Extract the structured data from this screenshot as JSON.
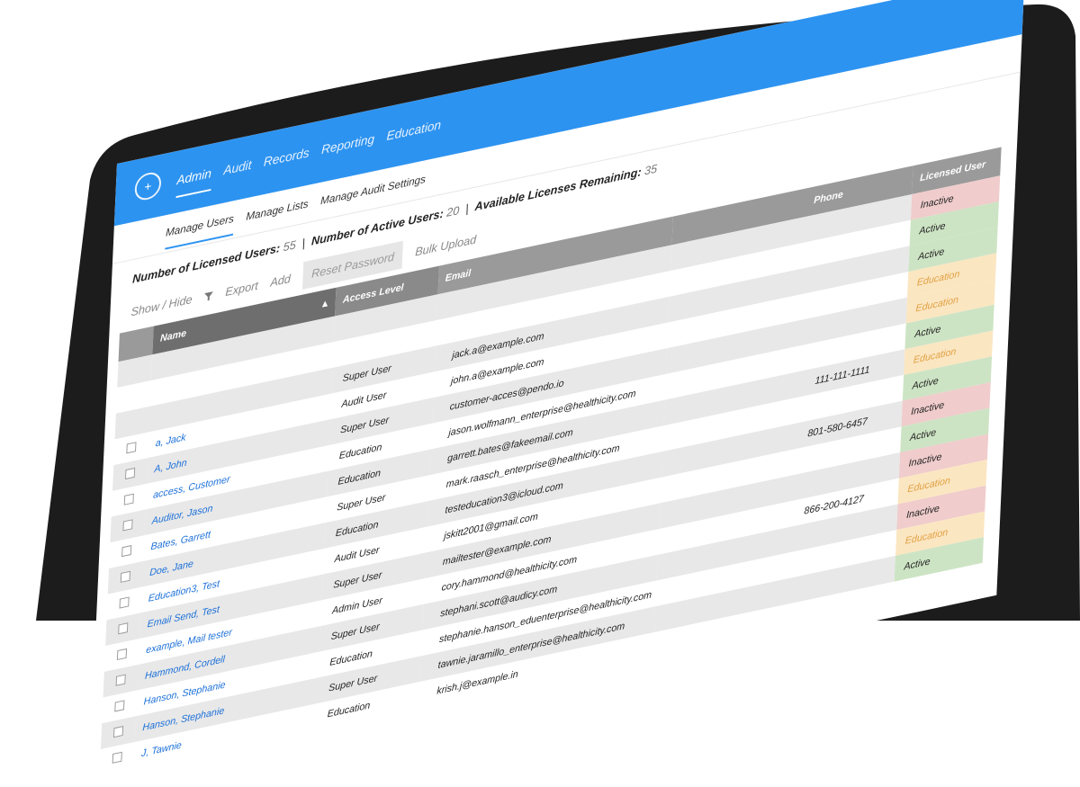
{
  "nav": {
    "items": [
      "Admin",
      "Audit",
      "Records",
      "Reporting",
      "Education"
    ],
    "active": "Admin"
  },
  "subnav": {
    "items": [
      "Manage Users",
      "Manage Lists",
      "Manage Audit Settings"
    ],
    "active": "Manage Users"
  },
  "counts": {
    "licensed_label": "Number of Licensed Users:",
    "licensed_value": "55",
    "active_label": "Number of Active Users:",
    "active_value": "20",
    "available_label": "Available Licenses Remaining:",
    "available_value": "35"
  },
  "toolbar": {
    "show_hide": "Show / Hide",
    "export": "Export",
    "add": "Add",
    "reset_password": "Reset Password",
    "bulk_upload": "Bulk Upload"
  },
  "table": {
    "headers": {
      "name": "Name",
      "access": "Access Level",
      "email": "Email",
      "phone": "Phone",
      "licensed": "Licensed User"
    },
    "rows": [
      {
        "name": "",
        "access": "",
        "email": "",
        "phone": "",
        "licensed": "Inactive"
      },
      {
        "name": "",
        "access": "",
        "email": "",
        "phone": "",
        "licensed": "Active"
      },
      {
        "name": "",
        "access": "Super User",
        "email": "jack.a@example.com",
        "phone": "",
        "licensed": "Active"
      },
      {
        "name": "a, Jack",
        "access": "Audit User",
        "email": "john.a@example.com",
        "phone": "",
        "licensed": "Education"
      },
      {
        "name": "A, John",
        "access": "Super User",
        "email": "customer-acces@pendo.io",
        "phone": "",
        "licensed": "Education"
      },
      {
        "name": "access, Customer",
        "access": "Education",
        "email": "jason.wolfmann_enterprise@healthicity.com",
        "phone": "",
        "licensed": "Active"
      },
      {
        "name": "Auditor, Jason",
        "access": "Education",
        "email": "garrett.bates@fakeemail.com",
        "phone": "111-111-1111",
        "licensed": "Education"
      },
      {
        "name": "Bates, Garrett",
        "access": "Super User",
        "email": "mark.raasch_enterprise@healthicity.com",
        "phone": "",
        "licensed": "Active"
      },
      {
        "name": "Doe, Jane",
        "access": "Education",
        "email": "testeducation3@icloud.com",
        "phone": "801-580-6457",
        "licensed": "Inactive"
      },
      {
        "name": "Education3, Test",
        "access": "Audit User",
        "email": "jskitt2001@gmail.com",
        "phone": "",
        "licensed": "Active"
      },
      {
        "name": "Email Send, Test",
        "access": "Super User",
        "email": "mailtester@example.com",
        "phone": "",
        "licensed": "Inactive"
      },
      {
        "name": "example, Mail tester",
        "access": "Admin User",
        "email": "cory.hammond@healthicity.com",
        "phone": "866-200-4127",
        "licensed": "Education"
      },
      {
        "name": "Hammond, Cordell",
        "access": "Super User",
        "email": "stephani.scott@audicy.com",
        "phone": "",
        "licensed": "Inactive"
      },
      {
        "name": "Hanson, Stephanie",
        "access": "Education",
        "email": "stephanie.hanson_eduenterprise@healthicity.com",
        "phone": "",
        "licensed": "Education"
      },
      {
        "name": "Hanson, Stephanie",
        "access": "Super User",
        "email": "tawnie.jaramillo_enterprise@healthicity.com",
        "phone": "",
        "licensed": "Active"
      },
      {
        "name": "J, Tawnie",
        "access": "Education",
        "email": "krish.j@example.in",
        "phone": "",
        "licensed": ""
      }
    ]
  },
  "colors": {
    "topbar": "#2d93f0",
    "inactive": "#f0cccc",
    "active": "#cde4c4",
    "education": "#fbe6c2",
    "link": "#1a6fd8"
  },
  "icons": {
    "logo": "plus-circle-icon",
    "filter": "filter-icon",
    "sort": "sort-up-icon"
  }
}
